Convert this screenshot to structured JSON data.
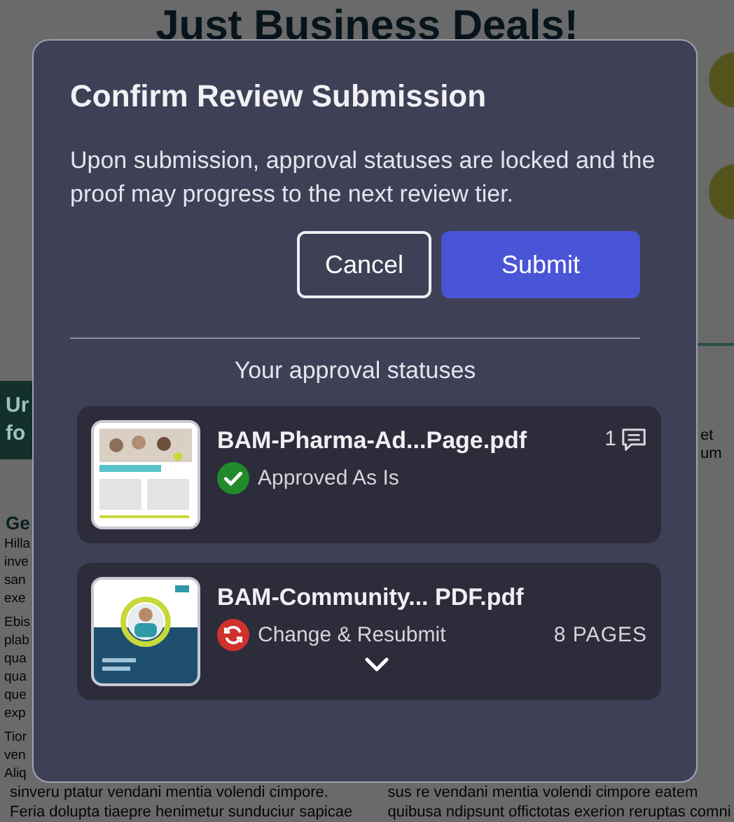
{
  "background": {
    "heading": "Just Business Deals!",
    "banner_fragments": [
      "Ur",
      "fo"
    ],
    "subheading_fragment": "Ge",
    "left_fragments": [
      "Hilla",
      "inve",
      "san",
      "exe",
      "Ebis",
      "plab",
      "qua",
      "qua",
      "que",
      "exp",
      "Tior",
      "ven",
      "Aliq"
    ],
    "right_fragments": [
      "et",
      "um"
    ],
    "bottom_left_lines": [
      "sinveru ptatur vendani mentia volendi cimpore.",
      "Feria dolupta tiaepre henimetur sunduciur sapicae"
    ],
    "bottom_right_lines": [
      "sus re vendani mentia volendi cimpore eatem",
      "quibusa ndipsunt offictotas exerion reruptas comni"
    ]
  },
  "dialog": {
    "title": "Confirm Review Submission",
    "message": "Upon submission, approval statuses are locked and the proof may progress to the next review tier.",
    "buttons": [
      {
        "label": "Cancel",
        "kind": "secondary"
      },
      {
        "label": "Submit",
        "kind": "primary"
      }
    ],
    "section_label": "Your approval statuses",
    "files": [
      {
        "name": "BAM-Pharma-Ad...Page.pdf",
        "kind": "approved",
        "status_label": "Approved As Is",
        "comment_count": "1"
      },
      {
        "name": "BAM-Community... PDF.pdf",
        "kind": "changes",
        "status_label": "Change & Resubmit",
        "pages": "8 PAGES",
        "expanded": false
      }
    ]
  }
}
